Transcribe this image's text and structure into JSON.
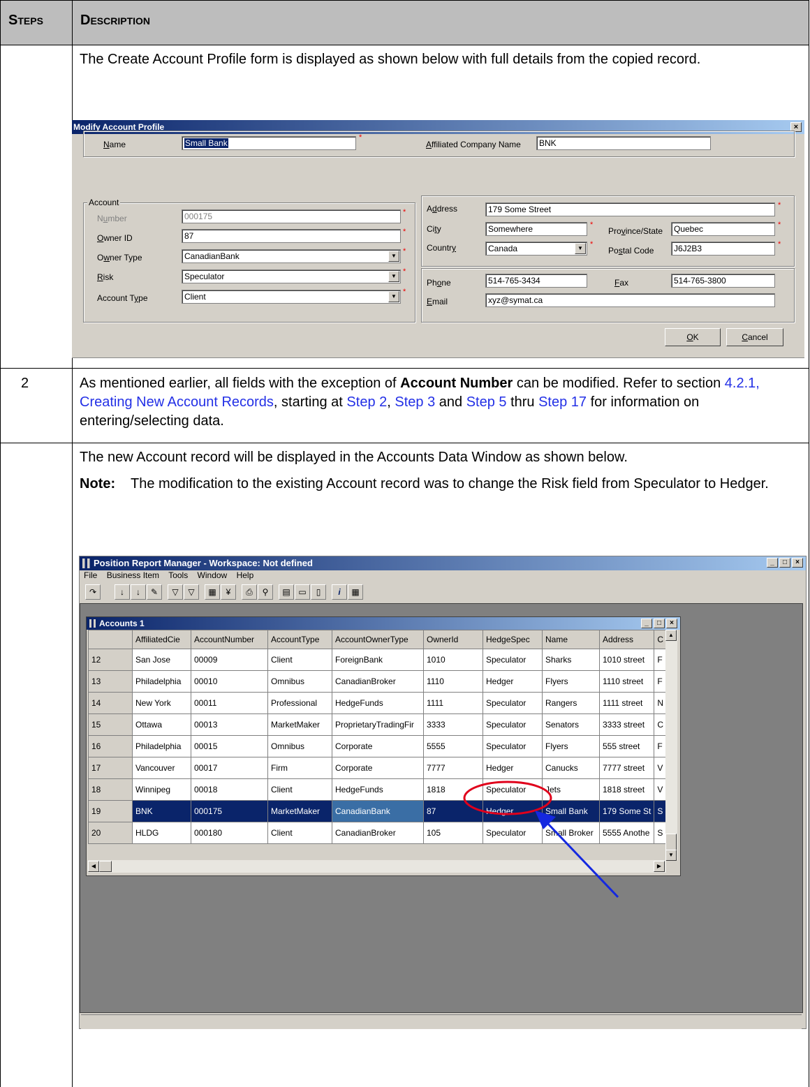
{
  "header": {
    "col1": "Steps",
    "col2": "Description"
  },
  "row1": {
    "text": "The Create Account Profile form is displayed as shown below with full details from the copied record."
  },
  "dialog": {
    "title": "Modify Account Profile",
    "close_glyph": "×",
    "name_label": "Name",
    "name_value": "Small Bank",
    "affiliated_label": "Affiliated Company Name",
    "affiliated_value": "BNK",
    "account_group": "Account",
    "number_label": "Number",
    "number_value": "000175",
    "owner_id_label": "Owner ID",
    "owner_id_value": "87",
    "owner_type_label": "Owner Type",
    "owner_type_value": "CanadianBank",
    "risk_label": "Risk",
    "risk_value": "Speculator",
    "account_type_label": "Account Type",
    "account_type_value": "Client",
    "address_label": "Address",
    "address_value": "179 Some Street",
    "city_label": "City",
    "city_value": "Somewhere",
    "province_label": "Province/State",
    "province_value": "Quebec",
    "country_label": "Country",
    "country_value": "Canada",
    "postal_label": "Postal Code",
    "postal_value": "J6J2B3",
    "phone_label": "Phone",
    "phone_value": "514-765-3434",
    "fax_label": "Fax",
    "fax_value": "514-765-3800",
    "email_label": "Email",
    "email_value": "xyz@symat.ca",
    "ok_label": "OK",
    "cancel_label": "Cancel",
    "required_mark": "*"
  },
  "row2": {
    "step": "2",
    "t1": "As mentioned earlier, all fields with the exception of ",
    "t1b": "Account Number",
    "t2": " can be modified. Refer to section ",
    "link_section": "4.2.1, Creating New Account Records",
    "t3": ", starting at ",
    "link_step2": "Step 2",
    "t4": ", ",
    "link_step3": "Step 3",
    "t5": " and ",
    "link_step5": "Step 5",
    "t6": " thru ",
    "link_step17": "Step 17",
    "t7": " for information on entering/selecting data."
  },
  "row3": {
    "text": "The new Account record will be displayed in the Accounts Data Window as shown below.",
    "note_label": "Note:",
    "note_text": "The modification to the existing Account record was to change the Risk field from Speculator to Hedger."
  },
  "app": {
    "title": "Position Report Manager - Workspace: Not defined",
    "menu": [
      "File",
      "Business Item",
      "Tools",
      "Window",
      "Help"
    ],
    "toolbar_icons": [
      "refresh-icon",
      "sort-asc-icon",
      "sort-desc-icon",
      "sort-custom-icon",
      "filter-icon",
      "filter-clear-icon",
      "calc-icon",
      "fork-icon",
      "print-icon",
      "find-icon",
      "tile-icon",
      "cascade-icon",
      "columns-icon",
      "info-icon",
      "grid-icon"
    ],
    "child_title": "Accounts 1",
    "columns": [
      "",
      "AffiliatedCie",
      "AccountNumber",
      "AccountType",
      "AccountOwnerType",
      "OwnerId",
      "HedgeSpec",
      "Name",
      "Address",
      "C"
    ],
    "rows": [
      [
        "12",
        "San Jose",
        "00009",
        "Client",
        "ForeignBank",
        "1010",
        "Speculator",
        "Sharks",
        "1010 street",
        "F"
      ],
      [
        "13",
        "Philadelphia",
        "00010",
        "Omnibus",
        "CanadianBroker",
        "1110",
        "Hedger",
        "Flyers",
        "1110 street",
        "F"
      ],
      [
        "14",
        "New York",
        "00011",
        "Professional",
        "HedgeFunds",
        "1111",
        "Speculator",
        "Rangers",
        "1111 street",
        "N"
      ],
      [
        "15",
        "Ottawa",
        "00013",
        "MarketMaker",
        "ProprietaryTradingFir",
        "3333",
        "Speculator",
        "Senators",
        "3333 street",
        "C"
      ],
      [
        "16",
        "Philadelphia",
        "00015",
        "Omnibus",
        "Corporate",
        "5555",
        "Speculator",
        "Flyers",
        "555 street",
        "F"
      ],
      [
        "17",
        "Vancouver",
        "00017",
        "Firm",
        "Corporate",
        "7777",
        "Hedger",
        "Canucks",
        "7777 street",
        "V"
      ],
      [
        "18",
        "Winnipeg",
        "00018",
        "Client",
        "HedgeFunds",
        "1818",
        "Speculator",
        "Jets",
        "1818 street",
        "V"
      ],
      [
        "19",
        "BNK",
        "000175",
        "MarketMaker",
        "CanadianBank",
        "87",
        "Hedger",
        "Small Bank",
        "179 Some St",
        "S"
      ],
      [
        "20",
        "HLDG",
        "000180",
        "Client",
        "CanadianBroker",
        "105",
        "Speculator",
        "Small Broker",
        "5555 Anothe",
        "S"
      ]
    ],
    "highlight_row": 7,
    "annotation_color": "#e0001b",
    "arrow_color": "#1428e0"
  }
}
